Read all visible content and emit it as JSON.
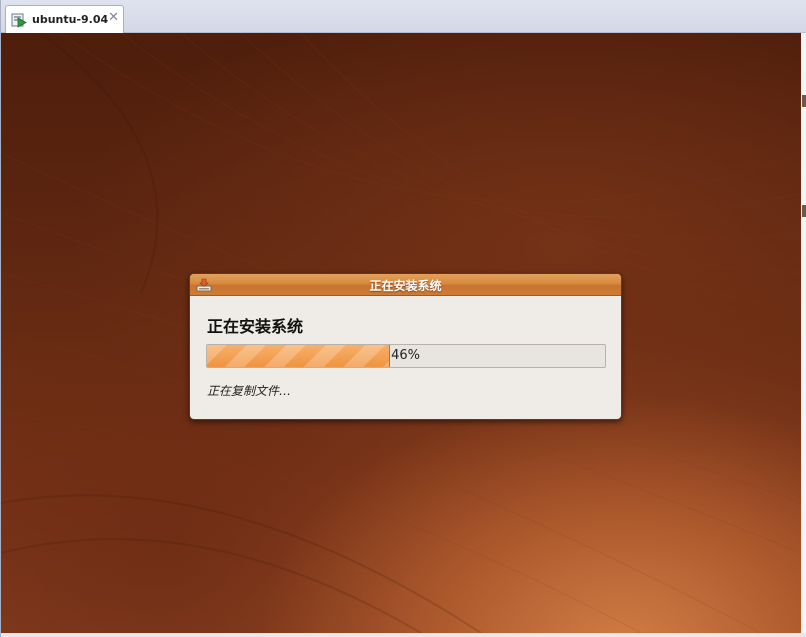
{
  "vm_tab": {
    "label": "ubuntu-9.04",
    "icon": "vm-play-icon",
    "close_icon": "close-icon",
    "close_glyph": "✕"
  },
  "installer": {
    "window_title": "正在安装系统",
    "heading": "正在安装系统",
    "progress_percent": 46,
    "progress_label": "46%",
    "status": "正在复制文件…",
    "icon": "installer-icon"
  },
  "colors": {
    "titlebar_orange": "#d88a3e",
    "progress_orange": "#ef9440",
    "dialog_bg": "#efebe7",
    "desktop_brown": "#5b2510"
  }
}
